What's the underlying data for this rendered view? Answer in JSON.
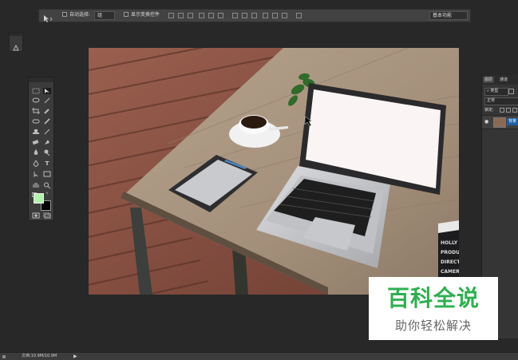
{
  "options_bar": {
    "auto_select_label": "自动选择:",
    "auto_select_value": "组",
    "show_transform_label": "显示变换控件",
    "workspace_value": "基本功能"
  },
  "layers_panel": {
    "tabs": [
      "图层",
      "通道"
    ],
    "filter_label": "类型",
    "blend_mode": "正常",
    "lock_label": "锁定:",
    "layer_name": "背景"
  },
  "watermark": {
    "title": "百科全说",
    "subtitle": "助你轻松解决"
  },
  "status_bar": {
    "doc_info": "文档:10.9M/10.9M"
  },
  "colors": {
    "foreground": "#b4f2b0",
    "background": "#000000",
    "watermark_green": "#2eb04f",
    "ui_background": "#282828"
  }
}
